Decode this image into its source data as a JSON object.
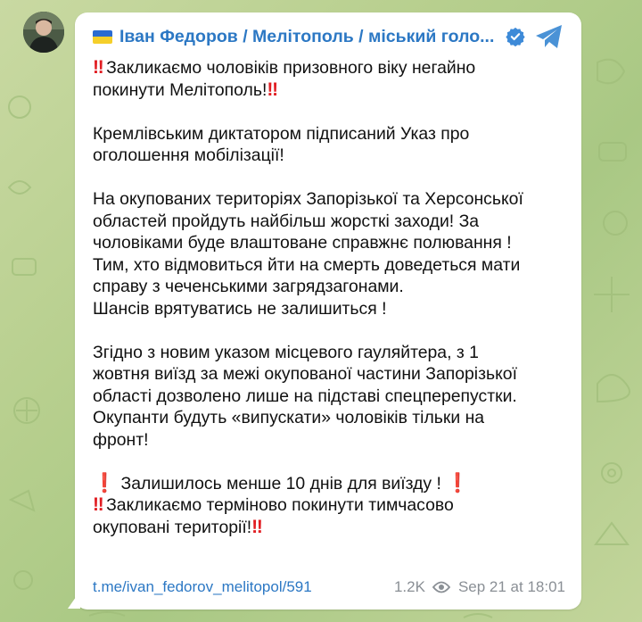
{
  "post": {
    "channel_name": "Іван Федоров / Мелітополь / міський голо...",
    "lines": {
      "l1": "Закликаємо чоловіків призовного віку негайно",
      "l2": "покинути Мелітополь!",
      "l3": "Кремлівським диктатором підписаний Указ про",
      "l4": "оголошення мобілізації!",
      "l5": "На окупованих територіях Запорізької та Херсонської",
      "l6": "областей пройдуть найбільш жорсткі заходи! За",
      "l7": "чоловіками буде влаштоване справжнє полювання !",
      "l8": "Тим, хто відмовиться йти на смерть доведеться мати",
      "l9": "справу з чеченськими загрядзагонами.",
      "l10": "Шансів врятуватись не залишиться !",
      "l11": "Згідно з новим указом місцевого гауляйтера, з 1",
      "l12": "жовтня виїзд за межі окупованої частини Запорізької",
      "l13": "області дозволено лише на підставі спецперепустки.",
      "l14": "Окупанти будуть «випускати» чоловіків тільки на",
      "l15": "фронт!",
      "l16": "Залишилось менше 10 днів для виїзду !",
      "l17": "Закликаємо терміново покинути тимчасово",
      "l18": "окуповані території!"
    },
    "link": "t.me/ivan_fedorov_melitopol/591",
    "views": "1.2K",
    "timestamp": "Sep 21 at 18:01"
  },
  "glyphs": {
    "double_bang": "‼",
    "single_bang": "❗"
  },
  "colors": {
    "accent": "#2c78c4",
    "alert": "#e11d22",
    "meta_text": "#8a8f95",
    "background": "#b7cf8e"
  },
  "icons": [
    "ukraine-flag-icon",
    "verified-badge-icon",
    "share-icon",
    "eye-icon"
  ]
}
